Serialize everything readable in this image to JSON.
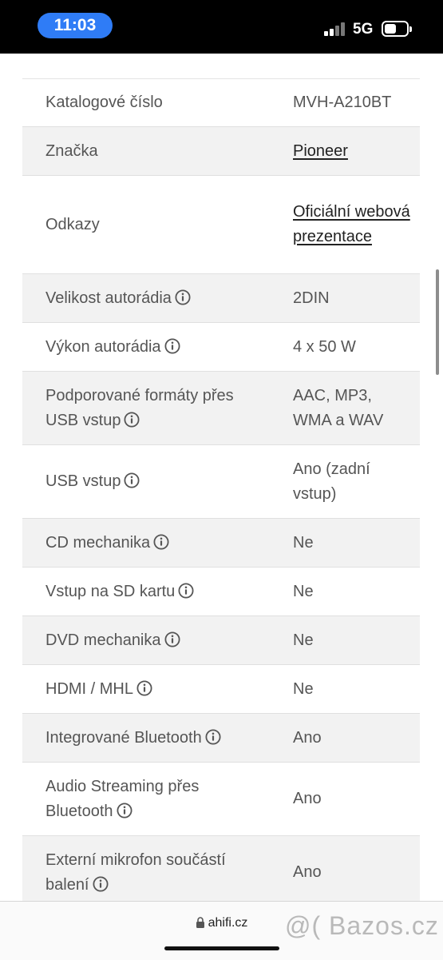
{
  "status_bar": {
    "time": "11:03",
    "network": "5G"
  },
  "specs": [
    {
      "label": "Katalogové číslo",
      "value": "MVH-A210BT",
      "info": false,
      "link": false
    },
    {
      "label": "Značka",
      "value": "Pioneer",
      "info": false,
      "link": true
    },
    {
      "label": "Odkazy",
      "value": "Oficiální webová prezentace",
      "info": false,
      "link": true
    },
    {
      "label": "Velikost autorádia",
      "value": "2DIN",
      "info": true,
      "link": false
    },
    {
      "label": "Výkon autorádia",
      "value": "4 x 50 W",
      "info": true,
      "link": false
    },
    {
      "label": "Podporované formáty přes USB vstup",
      "value": "AAC, MP3, WMA a WAV",
      "info": true,
      "link": false
    },
    {
      "label": "USB vstup",
      "value": "Ano (zadní vstup)",
      "info": true,
      "link": false
    },
    {
      "label": "CD mechanika",
      "value": "Ne",
      "info": true,
      "link": false
    },
    {
      "label": "Vstup na SD kartu",
      "value": "Ne",
      "info": true,
      "link": false
    },
    {
      "label": "DVD mechanika",
      "value": "Ne",
      "info": true,
      "link": false
    },
    {
      "label": "HDMI / MHL",
      "value": "Ne",
      "info": true,
      "link": false
    },
    {
      "label": "Integrované Bluetooth",
      "value": "Ano",
      "info": true,
      "link": false
    },
    {
      "label": "Audio Streaming přes Bluetooth",
      "value": "Ano",
      "info": true,
      "link": false
    },
    {
      "label": "Externí mikrofon součástí balení",
      "value": "Ano",
      "info": true,
      "link": false
    }
  ],
  "browser": {
    "url": "ahifi.cz"
  },
  "watermark": "@( Bazos.cz",
  "icons": {
    "info": "info-circle-icon",
    "lock": "lock-icon"
  }
}
